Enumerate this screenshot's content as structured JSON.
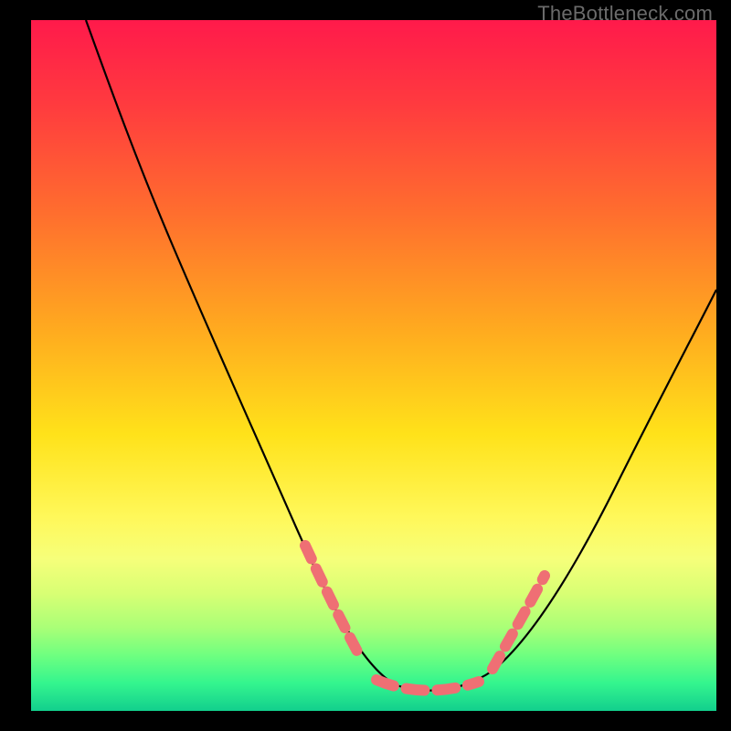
{
  "watermark": "TheBottleneck.com",
  "chart_data": {
    "type": "line",
    "title": "",
    "xlabel": "",
    "ylabel": "",
    "xlim": [
      0,
      100
    ],
    "ylim": [
      0,
      100
    ],
    "series": [
      {
        "name": "curve",
        "x": [
          8,
          12,
          18,
          24,
          30,
          36,
          41,
          45,
          48,
          50,
          52,
          55,
          58,
          61,
          64,
          68,
          73,
          79,
          86,
          94,
          100
        ],
        "y": [
          100,
          92,
          80,
          67,
          53,
          39,
          26,
          14,
          6,
          2,
          0,
          0,
          0,
          1,
          3,
          7,
          14,
          24,
          36,
          50,
          61
        ]
      }
    ],
    "highlight_segments": [
      {
        "side": "left",
        "x": [
          41,
          48
        ],
        "y": [
          26,
          6
        ]
      },
      {
        "side": "floor",
        "x": [
          50,
          64
        ],
        "y": [
          1,
          2
        ]
      },
      {
        "side": "right",
        "x": [
          66,
          73
        ],
        "y": [
          6,
          15
        ]
      }
    ],
    "colors": {
      "curve": "#000000",
      "highlight": "#ef6f74",
      "gradient_top": "#ff1a4b",
      "gradient_bottom": "#12cf8d"
    }
  }
}
